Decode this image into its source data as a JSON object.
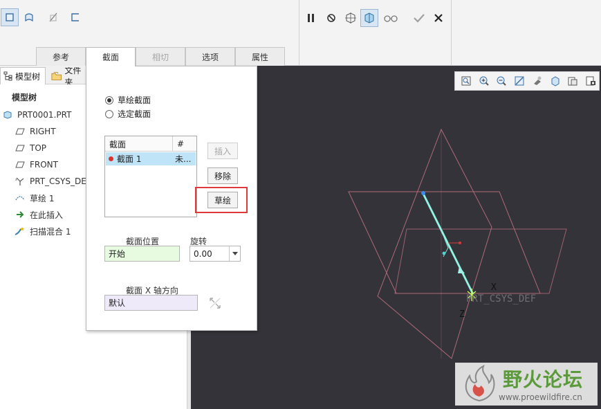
{
  "ribbon": {
    "tabs": [
      {
        "label": "参考",
        "state": "normal"
      },
      {
        "label": "截面",
        "state": "active"
      },
      {
        "label": "相切",
        "state": "disabled"
      },
      {
        "label": "选项",
        "state": "normal"
      },
      {
        "label": "属性",
        "state": "normal"
      }
    ],
    "left_tools": [
      "solid-icon",
      "surface-icon",
      "remove-material-icon",
      "thicken-icon"
    ],
    "right_tools": [
      "pause-icon",
      "no-preview-icon",
      "verify-icon",
      "preview-icon",
      "glasses-icon",
      "ok-check-icon",
      "cancel-x-icon"
    ]
  },
  "tree": {
    "tabs": [
      "模型树",
      "文件夹"
    ],
    "header": "模型树",
    "items": [
      {
        "label": "PRT0001.PRT",
        "icon": "part-icon"
      },
      {
        "label": "RIGHT",
        "icon": "datum-plane-icon"
      },
      {
        "label": "TOP",
        "icon": "datum-plane-icon"
      },
      {
        "label": "FRONT",
        "icon": "datum-plane-icon"
      },
      {
        "label": "PRT_CSYS_DEF",
        "icon": "csys-icon"
      },
      {
        "label": "草绘 1",
        "icon": "sketch-icon"
      },
      {
        "label": "在此插入",
        "icon": "insert-arrow-icon"
      },
      {
        "label": "扫描混合 1",
        "icon": "sweep-blend-icon"
      }
    ]
  },
  "panel": {
    "radio_sketch": "草绘截面",
    "radio_select": "选定截面",
    "table": {
      "col_section": "截面",
      "col_hash": "#",
      "row_section": "截面 1",
      "row_hash": "未..."
    },
    "btn_insert": "插入",
    "btn_remove": "移除",
    "btn_sketch": "草绘",
    "position_label": "截面位置",
    "position_value": "开始",
    "rotation_label": "旋转",
    "rotation_value": "0.00",
    "xaxis_label": "截面 X 轴方向",
    "xaxis_value": "默认"
  },
  "viewport": {
    "csys_label": "PRT_CSYS_DEF",
    "axis_x": "X",
    "axis_z": "Z",
    "tools": [
      "refit-icon",
      "zoom-in-icon",
      "zoom-out-icon",
      "repaint-icon",
      "display-style-icon",
      "saved-views-icon",
      "datum-display-icon",
      "annotation-icon"
    ],
    "colors": {
      "background": "#333339",
      "planes": "#b06a78",
      "curve": "#7de8d8"
    }
  },
  "watermark": {
    "title": "野火论坛",
    "url": "www.proewildfire.cn"
  }
}
